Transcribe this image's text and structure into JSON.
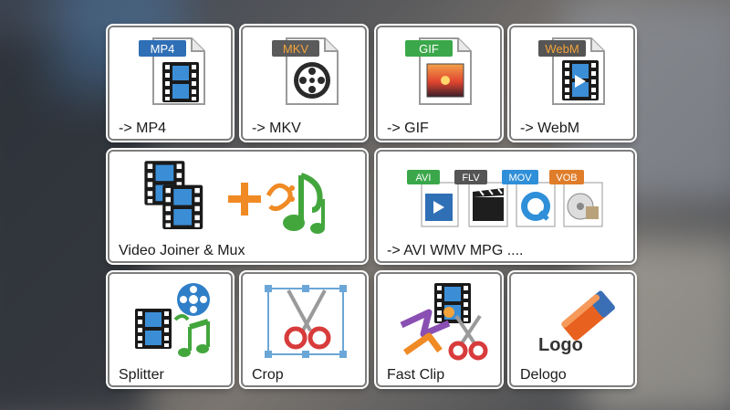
{
  "tiles": {
    "mp4": {
      "label": "-> MP4",
      "badge": "MP4"
    },
    "mkv": {
      "label": "-> MKV",
      "badge": "MKV"
    },
    "gif": {
      "label": "-> GIF",
      "badge": "GIF"
    },
    "webm": {
      "label": "-> WebM",
      "badge": "WebM"
    },
    "join": {
      "label": "Video Joiner & Mux"
    },
    "avi": {
      "label": "-> AVI WMV MPG ....",
      "badges": [
        "AVI",
        "FLV",
        "MOV",
        "VOB"
      ]
    },
    "split": {
      "label": "Splitter"
    },
    "crop": {
      "label": "Crop"
    },
    "fast": {
      "label": "Fast Clip"
    },
    "delo": {
      "label": "Delogo",
      "logo_text": "Logo"
    }
  },
  "colors": {
    "badge_mp4": "#2f6fb5",
    "badge_mkv": "#5a5a5a",
    "badge_gif": "#3aa84a",
    "badge_webm": "#555555",
    "badge_avi": "#3aa84a",
    "badge_flv": "#555555",
    "badge_mov": "#2f8fd8",
    "badge_vob": "#e07d2a"
  },
  "icons": {
    "mp4": "film-document-icon",
    "mkv": "film-reel-document-icon",
    "gif": "image-document-icon",
    "webm": "video-document-icon",
    "join": "film-plus-music-icon",
    "avi": "multi-format-icons",
    "split": "film-reel-music-icon",
    "crop": "crop-scissors-icon",
    "fast": "fast-clip-scissors-icon",
    "delo": "eraser-logo-icon"
  }
}
